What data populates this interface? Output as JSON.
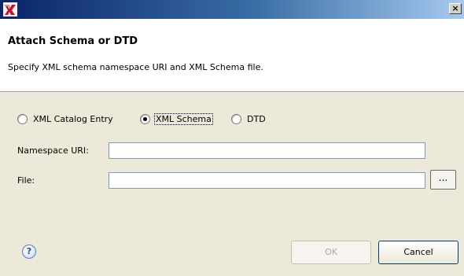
{
  "window": {
    "title": "",
    "close_label": "×",
    "app_icon": "schema-attach-icon"
  },
  "header": {
    "title": "Attach Schema or DTD",
    "description": "Specify XML schema namespace URI and XML Schema file."
  },
  "options": {
    "items": [
      {
        "label": "XML Catalog Entry",
        "checked": false
      },
      {
        "label": "XML Schema",
        "checked": true
      },
      {
        "label": "DTD",
        "checked": false
      }
    ]
  },
  "form": {
    "namespace_label": "Namespace URI:",
    "namespace_value": "",
    "file_label": "File:",
    "file_value": "",
    "browse_label": "..."
  },
  "footer": {
    "help_label": "?",
    "ok_label": "OK",
    "ok_enabled": false,
    "cancel_label": "Cancel"
  }
}
